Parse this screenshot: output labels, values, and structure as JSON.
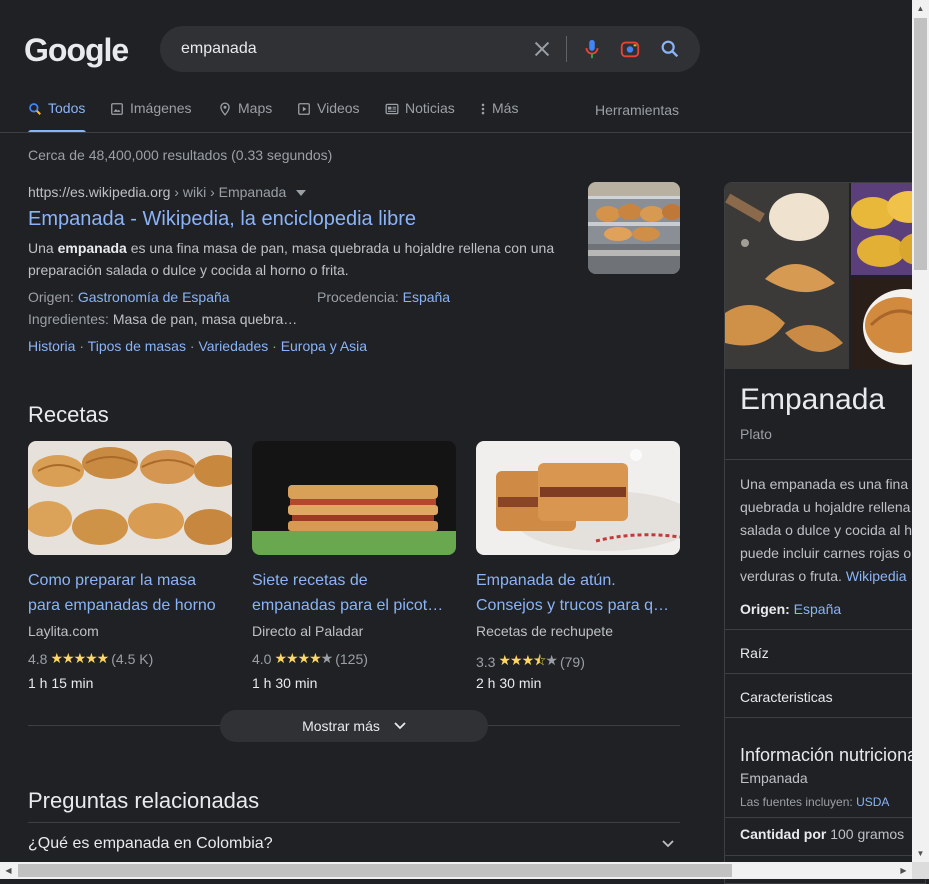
{
  "logo": "Google",
  "search": {
    "query": "empanada"
  },
  "tabs": [
    {
      "label": "Todos",
      "icon": "search-icon"
    },
    {
      "label": "Imágenes",
      "icon": "image-icon"
    },
    {
      "label": "Maps",
      "icon": "map-pin-icon"
    },
    {
      "label": "Videos",
      "icon": "play-icon"
    },
    {
      "label": "Noticias",
      "icon": "news-icon"
    },
    {
      "label": "Más",
      "icon": "more-vert-icon"
    }
  ],
  "tools_label": "Herramientas",
  "stats": "Cerca de 48,400,000 resultados (0.33 segundos)",
  "result": {
    "url": "https://es.wikipedia.org",
    "path": " › wiki › Empanada",
    "title": "Empanada - Wikipedia, la enciclopedia libre",
    "snippet_pre": "Una ",
    "snippet_bold": "empanada",
    "snippet_post": " es una fina masa de pan, masa quebrada u hojaldre rellena con una preparación salada o dulce y cocida al horno o frita.",
    "origin_label": "Origen: ",
    "origin_value": "Gastronomía de España",
    "provenance_label": "Procedencia: ",
    "provenance_value": "España",
    "ingredients_label": "Ingredientes: ",
    "ingredients_value": "Masa de pan, masa quebra…",
    "sitelinks": [
      "Historia",
      "Tipos de masas",
      "Variedades",
      "Europa y Asia"
    ]
  },
  "recipes": {
    "heading": "Recetas",
    "items": [
      {
        "title1": "Como preparar la masa",
        "title2": "para empanadas de horno",
        "source": "Laylita.com",
        "rating": "4.8",
        "stars_full": "★★★★★",
        "stars_off": "",
        "reviews": "(4.5 K)",
        "time": "1 h 15 min"
      },
      {
        "title1": "Siete recetas de",
        "title2": "empanadas para el picot…",
        "source": "Directo al Paladar",
        "rating": "4.0",
        "stars_full": "★★★★",
        "stars_off": "★",
        "reviews": "(125)",
        "time": "1 h 30 min"
      },
      {
        "title1": "Empanada de atún.",
        "title2": "Consejos y trucos para q…",
        "source": "Recetas de rechupete",
        "rating": "3.3",
        "stars_full": "★★★⯪",
        "stars_off": "★",
        "reviews": "(79)",
        "time": "2 h 30 min"
      }
    ],
    "more_label": "Mostrar más"
  },
  "paa": {
    "heading": "Preguntas relacionadas",
    "questions": [
      "¿Qué es empanada en Colombia?"
    ]
  },
  "knowledge_panel": {
    "title": "Empanada",
    "subtitle": "Plato",
    "desc_lines": [
      "Una empanada es una fina",
      "quebrada u hojaldre rellena",
      "salada o dulce y cocida al h",
      "puede incluir carnes rojas o",
      "verduras o fruta. "
    ],
    "desc_link": "Wikipedia",
    "origin_label": "Origen:",
    "origin_value": "España",
    "rows": [
      "Raíz",
      "Caracteristicas"
    ],
    "nutrition_title": "Información nutriciona",
    "nutrition_sub": "Empanada",
    "sources_label": "Las fuentes incluyen: ",
    "sources_link": "USDA",
    "qty_label": "Cantidad por",
    "qty_value": " 100 gramos"
  },
  "colors": {
    "background": "#202124",
    "link": "#8ab4f8",
    "star": "#fdd663"
  }
}
